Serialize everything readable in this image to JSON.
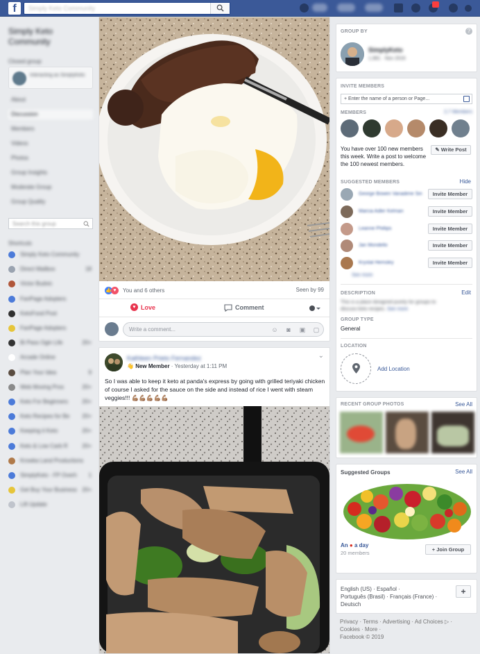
{
  "topbar": {
    "search_placeholder": "Simply Keto Community",
    "nav_items": [
      "Mike",
      "Home",
      "Create"
    ]
  },
  "left_sidebar": {
    "group_title": "Simply Keto Community",
    "group_subtitle": "Closed group",
    "joined_label": "Interacting as SimplyKeto",
    "nav": [
      "About",
      "Discussion",
      "Members",
      "Videos",
      "Photos",
      "Group Insights",
      "Moderate Group",
      "Group Quality"
    ],
    "search_placeholder": "Search this group",
    "shortcuts_header": "Shortcuts",
    "shortcuts": [
      {
        "label": "Simply Keto Community",
        "count": ""
      },
      {
        "label": "Direct Mailbox",
        "count": "18"
      },
      {
        "label": "Victor Budvic",
        "count": ""
      },
      {
        "label": "FanPage Adopters",
        "count": ""
      },
      {
        "label": "KetoFood Post",
        "count": ""
      },
      {
        "label": "FanPage Adopters",
        "count": ""
      },
      {
        "label": "Bi Pass Ogin Life",
        "count": "20+"
      },
      {
        "label": "Arcade Online",
        "count": ""
      },
      {
        "label": "Plan Your Idea",
        "count": "9"
      },
      {
        "label": "Web Moving Pros",
        "count": "20+"
      },
      {
        "label": "Keto For Beginners",
        "count": "20+"
      },
      {
        "label": "Keto Recipes for Be",
        "count": "20+"
      },
      {
        "label": "Keeping it Keto",
        "count": "20+"
      },
      {
        "label": "Keto & Low Carb R",
        "count": "20+"
      },
      {
        "label": "Krowka Land Productions",
        "count": ""
      },
      {
        "label": "SimplyKeto - FP Overh",
        "count": "1"
      },
      {
        "label": "Get Buy Your Business",
        "count": "20+"
      },
      {
        "label": "Lift Update",
        "count": ""
      }
    ]
  },
  "post1": {
    "reactions_text": "You and 6 others",
    "seen_text": "Seen by 99",
    "love_label": "Love",
    "comment_label": "Comment",
    "comment_placeholder": "Write a comment..."
  },
  "post2": {
    "author": "Kathleen Prieto Fernandez",
    "badge": "New Member",
    "time": " · Yesterday at 1:11 PM",
    "text": "So I was able to keep it keto at panda's express by going with grilled teriyaki chicken of course I asked for the sauce on the side and instead of rice I went with steam veggies!!! 💪🏽💪🏽💪🏽💪🏽💪🏽"
  },
  "right_sidebar": {
    "group_by": {
      "title": "GROUP BY",
      "name": "SimplyKeto",
      "sub": "1,981 · Nov 2016"
    },
    "invite": {
      "title": "INVITE MEMBERS",
      "placeholder": "+ Enter the name of a person or Page...",
      "members_title": "MEMBERS",
      "members_count": "2,7 Members",
      "notice": "You have over 100 new members this week. Write a post to welcome the 100 newest members.",
      "write_post": "Write Post",
      "suggested_title": "SUGGESTED MEMBERS",
      "hide": "Hide",
      "invite_label": "Invite Member",
      "suggested": [
        "George Bowen Vanadime Sin",
        "Marcia Adler Kelman",
        "Leanne Phillips",
        "Jan Mondello",
        "Krystal Hemsley"
      ],
      "see_more": "See more",
      "description_title": "DESCRIPTION",
      "edit": "Edit",
      "description_text": "This is a place designed purely for groups to discuss keto recipes.",
      "description_see_more": "See more",
      "group_type_title": "GROUP TYPE",
      "group_type": "General",
      "location_title": "LOCATION",
      "add_location": "Add Location"
    },
    "recent_photos": {
      "title": "RECENT GROUP PHOTOS",
      "see_all": "See All"
    },
    "suggested_groups": {
      "title": "Suggested Groups",
      "see_all": "See All",
      "group_name_pre": "An ",
      "group_name_post": " a day",
      "members": "20 members",
      "join": "Join Group"
    },
    "footer": {
      "languages_line1": "English (US) · Español ·",
      "languages_line2": "Português (Brasil) · Français (France) ·",
      "languages_line3": "Deutsch",
      "add_language": "+",
      "links_line1": "Privacy · Terms · Advertising · Ad Choices ▷ ·",
      "links_line2": "Cookies · More ·",
      "copyright": "Facebook © 2019"
    }
  },
  "colors": {
    "brand": "#3b5998",
    "link": "#385898",
    "love": "#e8344e"
  }
}
